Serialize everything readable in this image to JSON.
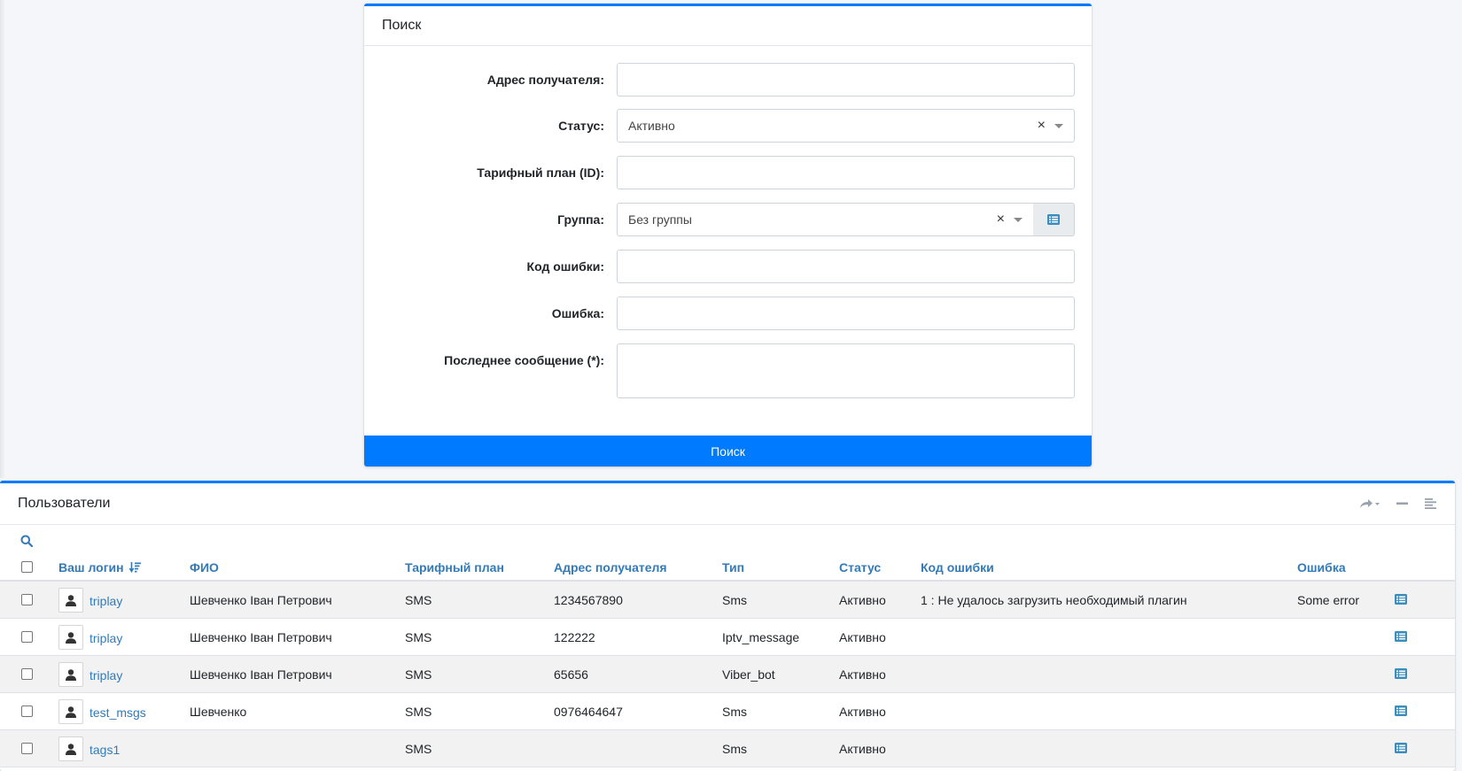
{
  "search": {
    "title": "Поиск",
    "fields": {
      "recipient_label": "Адрес получателя:",
      "recipient_value": "",
      "status_label": "Статус:",
      "status_value": "Активно",
      "tariff_label": "Тарифный план (ID):",
      "tariff_value": "",
      "group_label": "Группа:",
      "group_value": "Без группы",
      "error_code_label": "Код ошибки:",
      "error_code_value": "",
      "error_label": "Ошибка:",
      "error_value": "",
      "last_message_label": "Последнее сообщение (*):",
      "last_message_value": ""
    },
    "clear_glyph": "×",
    "submit_label": "Поиск"
  },
  "users": {
    "title": "Пользователи",
    "icons": [
      "share-icon",
      "minimize-icon",
      "list-icon",
      "search-icon",
      "sort-icon",
      "user-icon",
      "details-icon"
    ],
    "columns": {
      "login": "Ваш логин",
      "fio": "ФИО",
      "tariff": "Тарифный план",
      "address": "Адрес получателя",
      "type": "Тип",
      "status": "Статус",
      "error_code": "Код ошибки",
      "error": "Ошибка"
    },
    "rows": [
      {
        "login": "triplay",
        "fio": "Шевченко Іван Петрович",
        "tariff": "SMS",
        "address": "1234567890",
        "type": "Sms",
        "status": "Активно",
        "error_code": "1 : Не удалось загрузить необходимый плагин",
        "error": "Some error"
      },
      {
        "login": "triplay",
        "fio": "Шевченко Іван Петрович",
        "tariff": "SMS",
        "address": "122222",
        "type": "Iptv_message",
        "status": "Активно",
        "error_code": "",
        "error": ""
      },
      {
        "login": "triplay",
        "fio": "Шевченко Іван Петрович",
        "tariff": "SMS",
        "address": "65656",
        "type": "Viber_bot",
        "status": "Активно",
        "error_code": "",
        "error": ""
      },
      {
        "login": "test_msgs",
        "fio": "Шевченко",
        "tariff": "SMS",
        "address": "0976464647",
        "type": "Sms",
        "status": "Активно",
        "error_code": "",
        "error": ""
      },
      {
        "login": "tags1",
        "fio": "",
        "tariff": "SMS",
        "address": "",
        "type": "Sms",
        "status": "Активно",
        "error_code": "",
        "error": ""
      }
    ]
  },
  "colors": {
    "accent": "#007bff",
    "link": "#337ab7",
    "row_alt": "#f2f2f2"
  }
}
